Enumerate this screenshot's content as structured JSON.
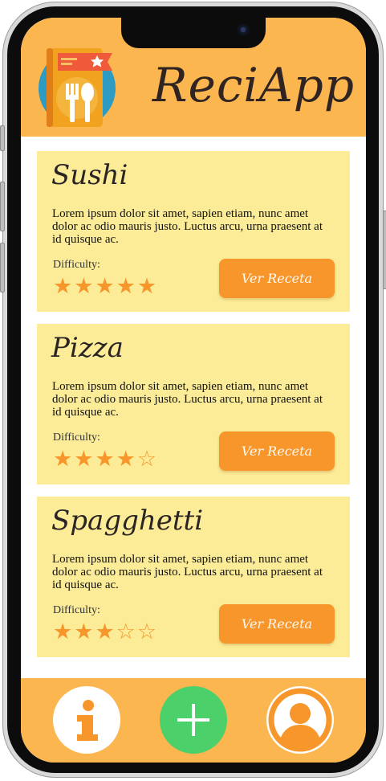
{
  "app": {
    "title": "ReciApp",
    "logo_icon": "recipe-book-icon"
  },
  "recipes": [
    {
      "title": "Sushi",
      "description": "Lorem ipsum dolor sit amet, sapien etiam, nunc amet dolor ac odio mauris justo. Luctus arcu, urna praesent at id quisque ac.",
      "difficulty_label": "Difficulty:",
      "rating": 5,
      "rating_max": 5,
      "button_label": "Ver Receta"
    },
    {
      "title": "Pizza",
      "description": "Lorem ipsum dolor sit amet, sapien etiam, nunc amet dolor ac odio mauris justo. Luctus arcu, urna praesent at id quisque ac.",
      "difficulty_label": "Difficulty:",
      "rating": 4,
      "rating_max": 5,
      "button_label": "Ver Receta"
    },
    {
      "title": "Spagghetti",
      "description": "Lorem ipsum dolor sit amet, sapien etiam, nunc amet dolor ac odio mauris justo. Luctus arcu, urna praesent at id quisque ac.",
      "difficulty_label": "Difficulty:",
      "rating": 3,
      "rating_max": 5,
      "button_label": "Ver Receta"
    }
  ],
  "bottom_nav": {
    "items": [
      {
        "icon": "info-icon"
      },
      {
        "icon": "plus-icon"
      },
      {
        "icon": "user-icon"
      }
    ]
  },
  "colors": {
    "header": "#fcb64f",
    "card": "#fcec97",
    "accent": "#f7962b",
    "add_button": "#4cd06a"
  }
}
